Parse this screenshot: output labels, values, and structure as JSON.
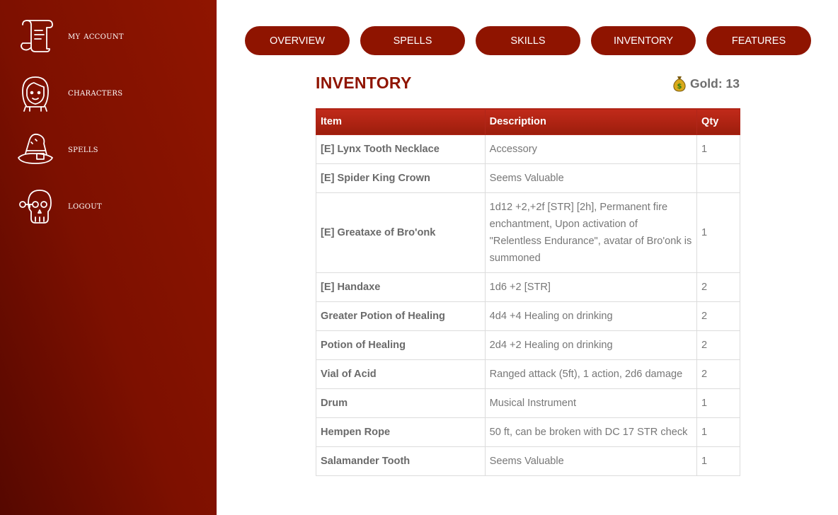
{
  "sidebar": {
    "items": [
      {
        "label": "MY ACCOUNT",
        "icon": "scroll-icon"
      },
      {
        "label": "CHARACTERS",
        "icon": "character-face-icon"
      },
      {
        "label": "SPELLS",
        "icon": "wizard-hat-icon"
      },
      {
        "label": "LOGOUT",
        "icon": "skull-key-icon"
      }
    ]
  },
  "tabs": [
    "OVERVIEW",
    "SPELLS",
    "SKILLS",
    "INVENTORY",
    "FEATURES"
  ],
  "inventory": {
    "title": "INVENTORY",
    "gold_label": "Gold: 13",
    "gold_icon": "money-bag-icon",
    "columns": [
      "Item",
      "Description",
      "Qty"
    ],
    "rows": [
      {
        "item": "[E] Lynx Tooth Necklace",
        "description": "Accessory",
        "qty": "1"
      },
      {
        "item": "[E] Spider King Crown",
        "description": "Seems Valuable",
        "qty": ""
      },
      {
        "item": "[E] Greataxe of Bro'onk",
        "description": "1d12 +2,+2f [STR] [2h], Permanent fire enchantment, Upon activation of \"Relentless Endurance\", avatar of Bro'onk is summoned",
        "qty": "1"
      },
      {
        "item": "[E] Handaxe",
        "description": "1d6 +2 [STR]",
        "qty": "2"
      },
      {
        "item": "Greater Potion of Healing",
        "description": "4d4 +4 Healing on drinking",
        "qty": "2"
      },
      {
        "item": "Potion of Healing",
        "description": "2d4 +2 Healing on drinking",
        "qty": "2"
      },
      {
        "item": "Vial of Acid",
        "description": "Ranged attack (5ft), 1 action, 2d6 damage",
        "qty": "2"
      },
      {
        "item": "Drum",
        "description": "Musical Instrument",
        "qty": "1"
      },
      {
        "item": "Hempen Rope",
        "description": "50 ft, can be broken with DC 17 STR check",
        "qty": "1"
      },
      {
        "item": "Salamander Tooth",
        "description": "Seems Valuable",
        "qty": "1"
      }
    ]
  },
  "colors": {
    "accent": "#8f1400",
    "sidebar_dark": "#560800",
    "table_header": "#c12a1a"
  }
}
